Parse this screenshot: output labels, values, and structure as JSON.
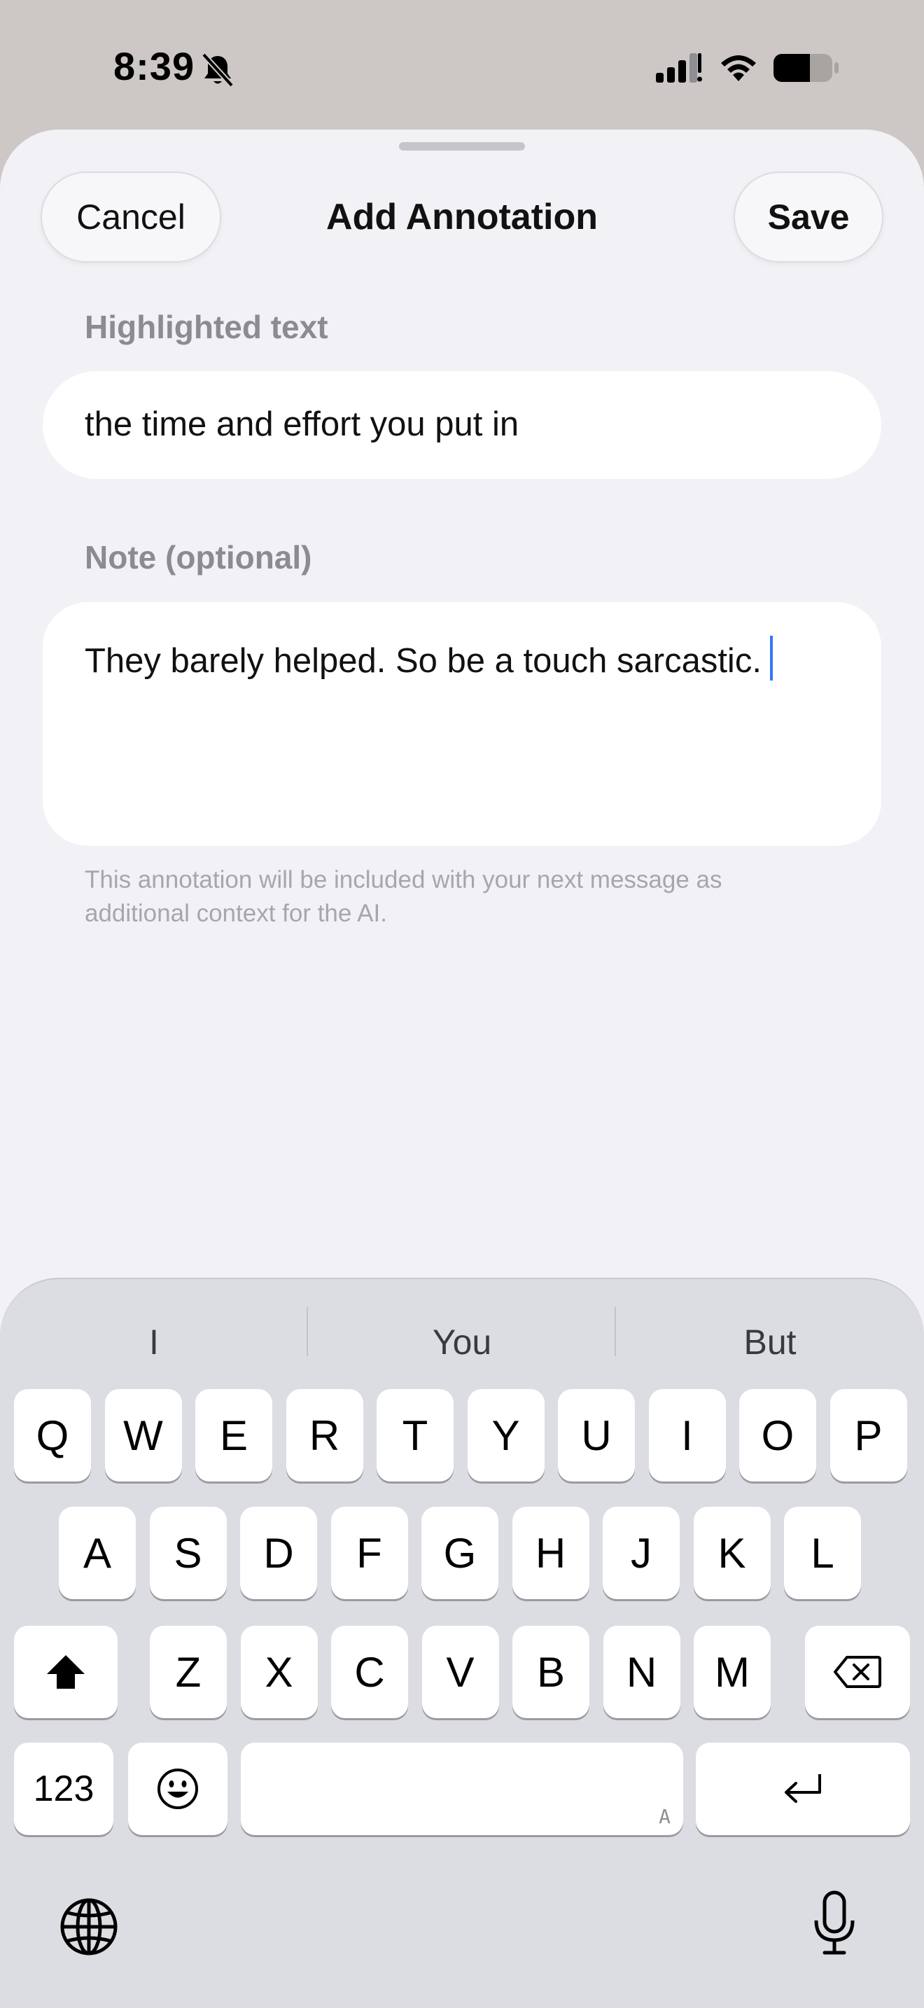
{
  "status_bar": {
    "time": "8:39",
    "icons": [
      "bell-slash-icon",
      "cellular-signal-icon",
      "wifi-icon",
      "battery-icon"
    ]
  },
  "sheet": {
    "title": "Add Annotation",
    "cancel_label": "Cancel",
    "save_label": "Save",
    "highlight_label": "Highlighted text",
    "highlight_value": "the time and effort you put in",
    "note_label": "Note (optional)",
    "note_value": "They barely helped. So be a touch sarcastic.",
    "footnote": "This annotation will be included with your next message as additional context for the AI."
  },
  "keyboard": {
    "suggestions": [
      "I",
      "You",
      "But"
    ],
    "row1": [
      "Q",
      "W",
      "E",
      "R",
      "T",
      "Y",
      "U",
      "I",
      "O",
      "P"
    ],
    "row2": [
      "A",
      "S",
      "D",
      "F",
      "G",
      "H",
      "J",
      "K",
      "L"
    ],
    "row3": [
      "Z",
      "X",
      "C",
      "V",
      "B",
      "N",
      "M"
    ],
    "numbers_label": "123",
    "space_hint": "A",
    "icons": [
      "shift-icon",
      "delete-icon",
      "emoji-icon",
      "return-icon",
      "globe-icon",
      "microphone-icon"
    ]
  }
}
